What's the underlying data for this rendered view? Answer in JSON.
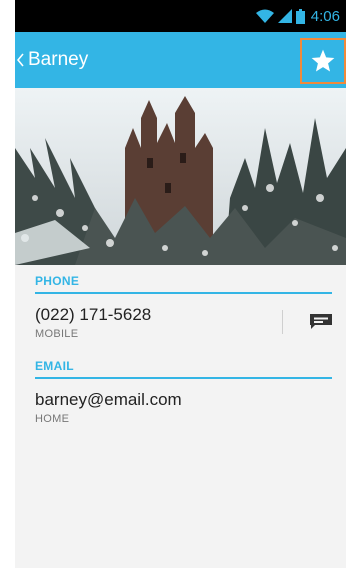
{
  "status_bar": {
    "time": "4:06",
    "icons": [
      "wifi-icon",
      "signal-icon",
      "battery-icon"
    ]
  },
  "action_bar": {
    "title": "Barney",
    "up_icon": "chevron-left-icon",
    "star_icon": "star-icon"
  },
  "sections": {
    "phone": {
      "header": "PHONE",
      "value": "(022) 171-5628",
      "type": "MOBILE",
      "action_icon": "message-icon"
    },
    "email": {
      "header": "EMAIL",
      "value": "barney@email.com",
      "type": "HOME"
    }
  },
  "colors": {
    "accent": "#33b5e5",
    "highlight": "#f08a3c",
    "status_bar": "#000000"
  }
}
